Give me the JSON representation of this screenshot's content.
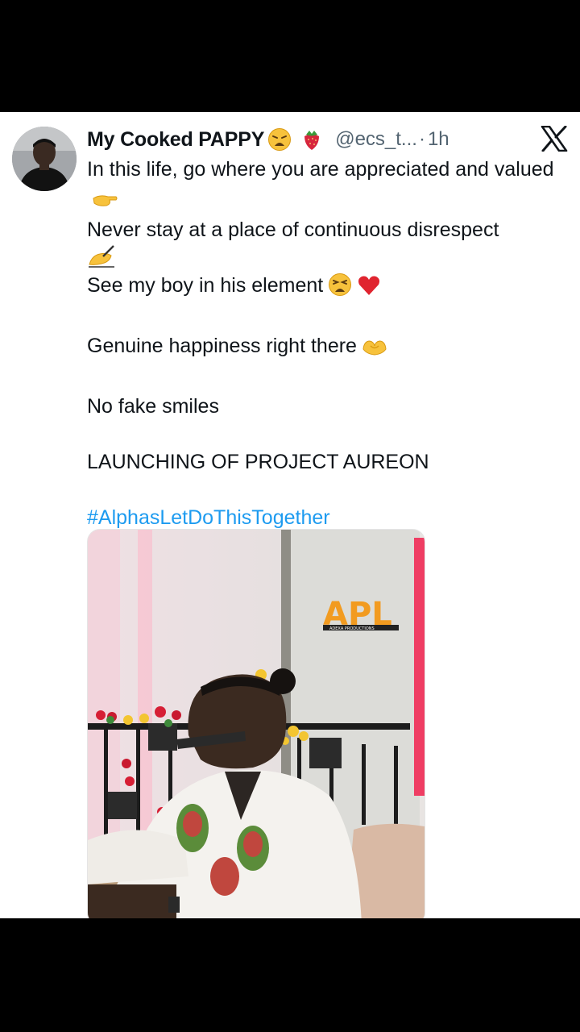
{
  "tweet": {
    "display_name": "My Cooked PAPPY",
    "name_emojis": [
      "weary-face-emoji",
      "strawberry-emoji"
    ],
    "handle": "@ecs_t...",
    "separator": "·",
    "time": "1h",
    "platform_icon": "x-logo-icon",
    "lines": {
      "l1": "In this life, go where you are appreciated and valued",
      "l2": "Never stay at a place of continuous disrespect",
      "l3": "See my boy in his element",
      "l4": "Genuine happiness right there",
      "l5": "No fake smiles",
      "l6": "LAUNCHING OF PROJECT AUREON",
      "hashtag": "#AlphasLetDoThisTogether"
    },
    "media": {
      "watermark": "APL",
      "watermark_sub": "ADEXA PRODUCTIONS"
    }
  }
}
